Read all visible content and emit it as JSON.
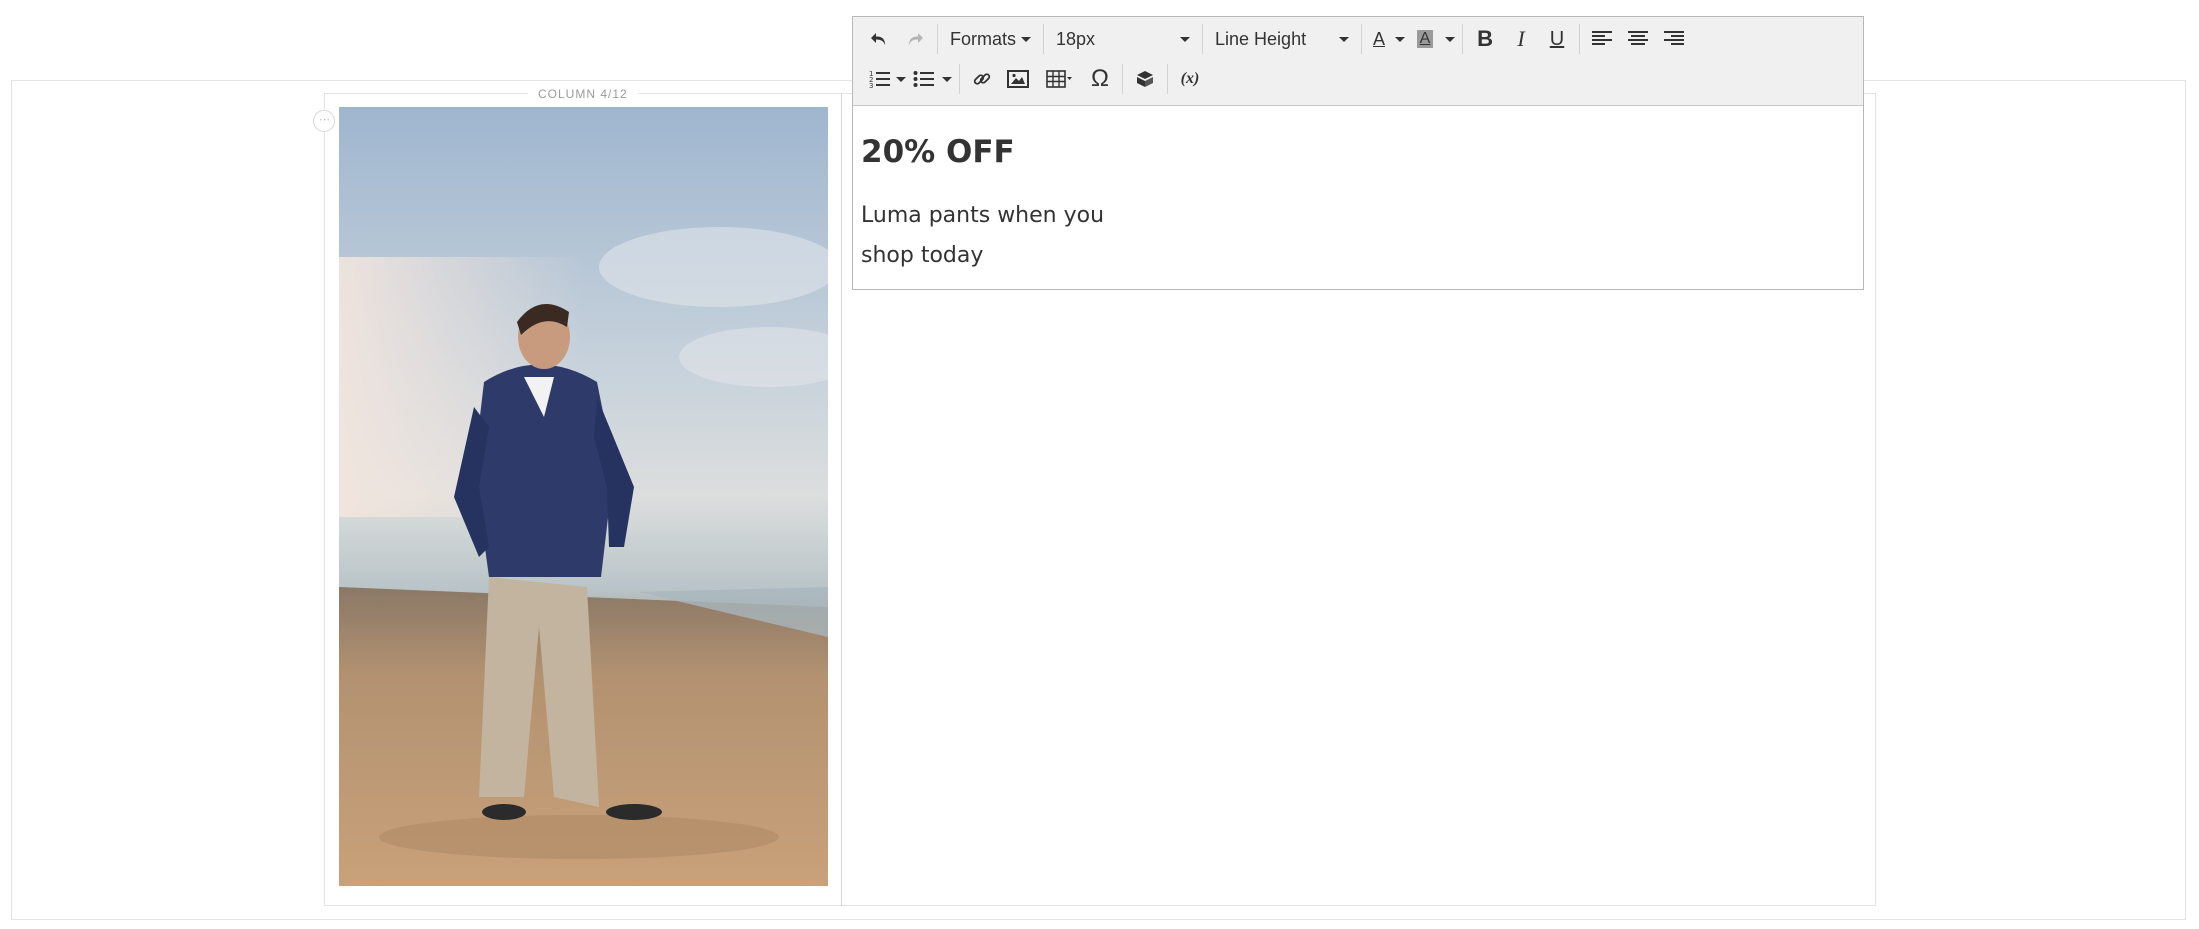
{
  "stage": {
    "column_label": "COLUMN 4/12",
    "drag_handle_glyph": "⋯"
  },
  "image": {
    "alt": "Man in navy hoodie and khaki pants standing on a beach"
  },
  "editor": {
    "toolbar": {
      "undo_icon": "undo-icon",
      "redo_icon": "redo-icon",
      "formats_label": "Formats",
      "font_size_label": "18px",
      "line_height_label": "Line Height",
      "text_color_glyph": "A",
      "bg_color_glyph": "A",
      "bold_glyph": "B",
      "italic_glyph": "I",
      "underline_glyph": "U",
      "special_char_glyph": "Ω",
      "variable_glyph": "(x)"
    },
    "content": {
      "heading": "20% OFF",
      "line1": "Luma pants when you",
      "line2": "shop today"
    }
  }
}
